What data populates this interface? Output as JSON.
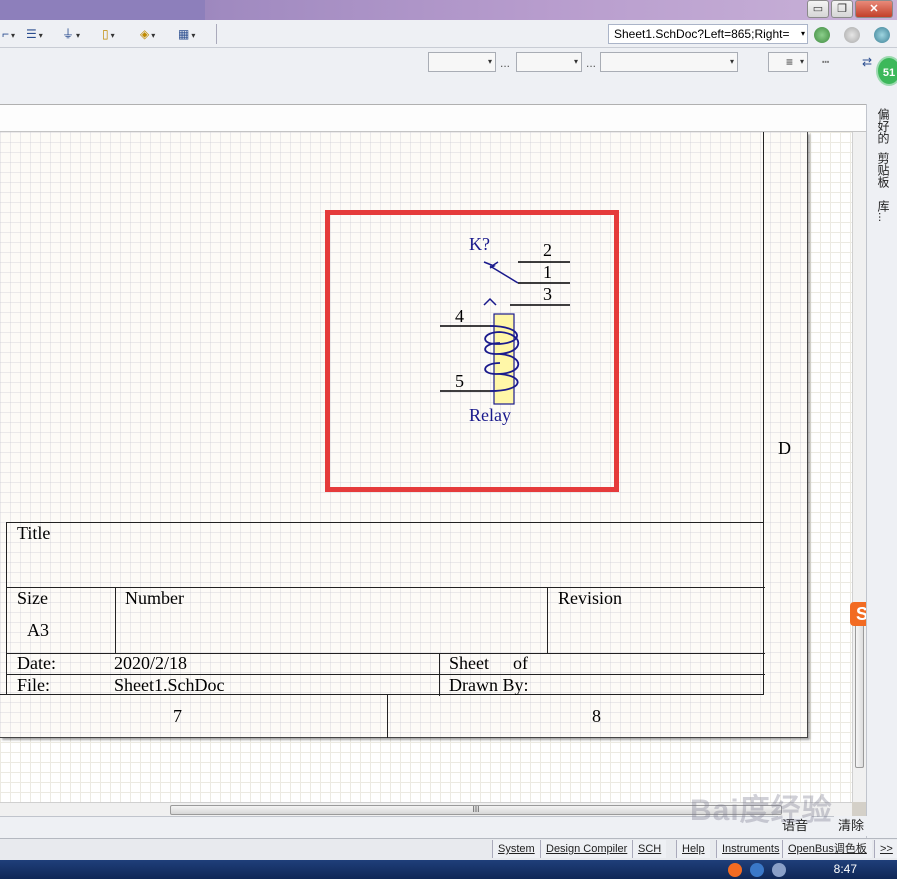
{
  "window": {
    "tab_path": "Sheet1.SchDoc?Left=865;Right=",
    "minimize_glyph": "▭",
    "restore_glyph": "❐",
    "close_glyph": "✕",
    "badge": "51"
  },
  "toolbar": {
    "arrow": "▾",
    "dots": "...",
    "grid_glyph": "▦",
    "scroll_grip": "III"
  },
  "right_panel": {
    "tabs": [
      "偏好的",
      "剪贴板",
      "库..."
    ]
  },
  "schematic": {
    "component": {
      "designator": "K?",
      "comment": "Relay",
      "pins": [
        "2",
        "1",
        "3",
        "4",
        "5"
      ]
    },
    "zone_letter": "D",
    "columns": [
      "7",
      "8"
    ],
    "title_block": {
      "title_label": "Title",
      "size_label": "Size",
      "size_value": "A3",
      "number_label": "Number",
      "revision_label": "Revision",
      "date_label": "Date:",
      "date_value": "2020/2/18",
      "sheet_label": "Sheet",
      "of_label": "of",
      "file_label": "File:",
      "file_value": "Sheet1.SchDoc",
      "drawn_by_label": "Drawn By:"
    }
  },
  "ime": {
    "label1": "语音",
    "label2": "清除",
    "sogou": "S"
  },
  "status_tabs": [
    "System",
    "Design Compiler",
    "SCH",
    "Help",
    "Instruments",
    "OpenBus调色板",
    ">>"
  ],
  "taskbar": {
    "clock": "8:47"
  },
  "watermark": "Bai度经验",
  "colors": {
    "highlight": "#e53b3b",
    "schematic_blue": "#1a1a8c",
    "relay_fill": "#fff7a8"
  }
}
